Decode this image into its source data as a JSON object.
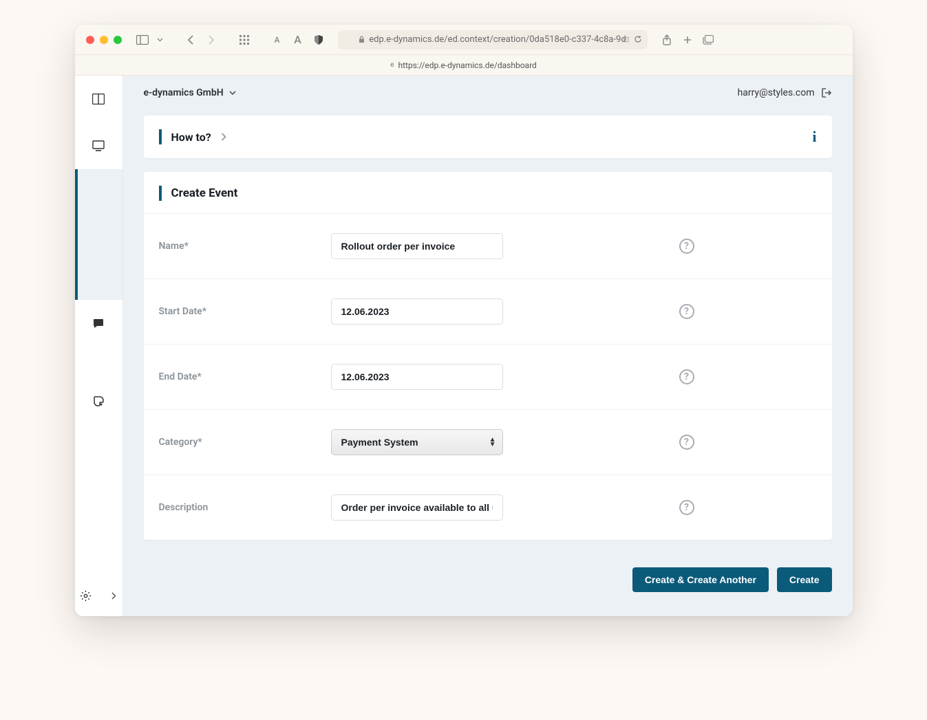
{
  "browser": {
    "url_display": "edp.e-dynamics.de/ed.context/creation/0da518e0-c337-4c8a-9d",
    "tab_url": "https://edp.e-dynamics.de/dashboard"
  },
  "header": {
    "org_name": "e-dynamics GmbH",
    "user_email": "harry@styles.com"
  },
  "howto": {
    "title": "How to?"
  },
  "panel": {
    "title": "Create Event"
  },
  "form": {
    "name_label": "Name*",
    "name_value": "Rollout order per invoice",
    "start_label": "Start Date*",
    "start_value": "12.06.2023",
    "end_label": "End Date*",
    "end_value": "12.06.2023",
    "category_label": "Category*",
    "category_value": "Payment System",
    "description_label": "Description",
    "description_value": "Order per invoice available to all users"
  },
  "actions": {
    "create_another": "Create & Create Another",
    "create": "Create"
  }
}
